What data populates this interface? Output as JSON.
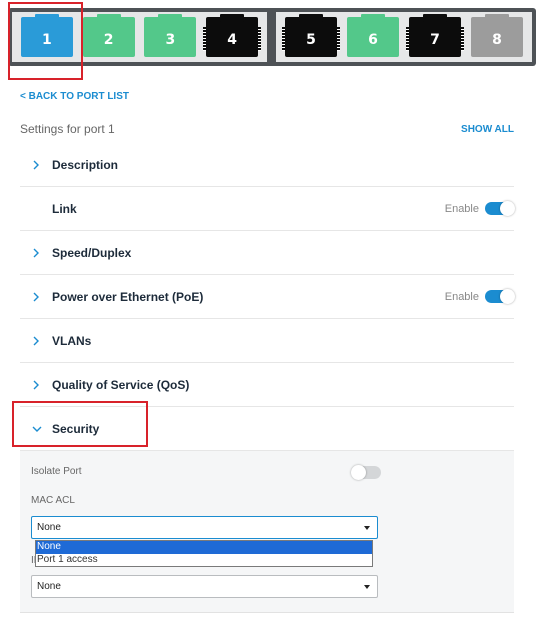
{
  "ports": [
    {
      "label": "1",
      "color": "#2a9bd8"
    },
    {
      "label": "2",
      "color": "#53c88a"
    },
    {
      "label": "3",
      "color": "#53c88a"
    },
    {
      "label": "4",
      "color": "#0c0c0c"
    },
    {
      "label": "5",
      "color": "#0c0c0c"
    },
    {
      "label": "6",
      "color": "#53c88a"
    },
    {
      "label": "7",
      "color": "#0c0c0c"
    },
    {
      "label": "8",
      "color": "#9c9c9c"
    }
  ],
  "header": {
    "back_link": "< BACK TO PORT LIST",
    "settings_title": "Settings for port 1",
    "show_all": "SHOW ALL"
  },
  "sections": {
    "description": {
      "label": "Description"
    },
    "link": {
      "label": "Link",
      "toggle_label": "Enable",
      "enabled": true
    },
    "speed_duplex": {
      "label": "Speed/Duplex"
    },
    "poe": {
      "label": "Power over Ethernet (PoE)",
      "toggle_label": "Enable",
      "enabled": true
    },
    "vlans": {
      "label": "VLANs"
    },
    "qos": {
      "label": "Quality of Service (QoS)"
    },
    "security": {
      "label": "Security",
      "expanded": true
    }
  },
  "security_panel": {
    "isolate_port": {
      "label": "Isolate Port",
      "enabled": false
    },
    "mac_acl": {
      "label": "MAC ACL",
      "value": "None",
      "options": [
        "None",
        "Port 1 access"
      ],
      "highlighted_option": "None"
    },
    "ip_acl": {
      "label_partial": "IP",
      "value": "None"
    }
  },
  "colors": {
    "accent": "#1b8cd0",
    "highlight_box": "#d8222a",
    "dropdown_selected": "#1e6ad6"
  }
}
